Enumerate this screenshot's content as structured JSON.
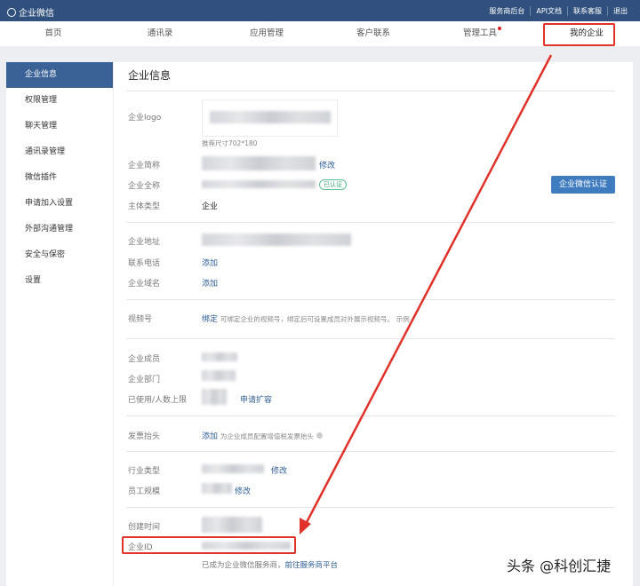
{
  "topbar": {
    "brand": "企业微信",
    "links": [
      "服务商后台",
      "API文档",
      "联系客服",
      "退出"
    ]
  },
  "nav": [
    "首页",
    "通讯录",
    "应用管理",
    "客户联系",
    "管理工具",
    "我的企业"
  ],
  "sidebar": [
    "企业信息",
    "权限管理",
    "聊天管理",
    "通讯录管理",
    "微信插件",
    "申请加入设置",
    "外部沟通管理",
    "安全与保密",
    "设置"
  ],
  "main": {
    "title": "企业信息",
    "logo_label": "企业logo",
    "logo_hint": "推荐尺寸702*180",
    "short_name_label": "企业简称",
    "edit": "修改",
    "full_name_label": "企业全称",
    "verified": "已认证",
    "type_label": "主体类型",
    "type_value": "企业",
    "verify_button": "企业微信认证",
    "address_label": "企业地址",
    "phone_label": "联系电话",
    "domain_label": "企业域名",
    "add": "添加",
    "channels_label": "视频号",
    "bind": "绑定",
    "channels_hint": "可绑定企业的视频号，绑定后可设置成员对外展示视频号。",
    "example": "示例",
    "members_label": "企业成员",
    "departments_label": "企业部门",
    "limit_label": "已使用/人数上限",
    "expand": "申请扩容",
    "invoice_label": "发票抬头",
    "invoice_hint": "为企业成员配置增值税发票抬头",
    "industry_label": "行业类型",
    "scale_label": "员工规模",
    "scale_edit": "修改",
    "created_label": "创建时间",
    "corp_id_label": "企业ID",
    "provider_text": "已成为企业微信服务商，",
    "provider_link": "前往服务商平台"
  },
  "watermark": "头条 @科创汇捷"
}
